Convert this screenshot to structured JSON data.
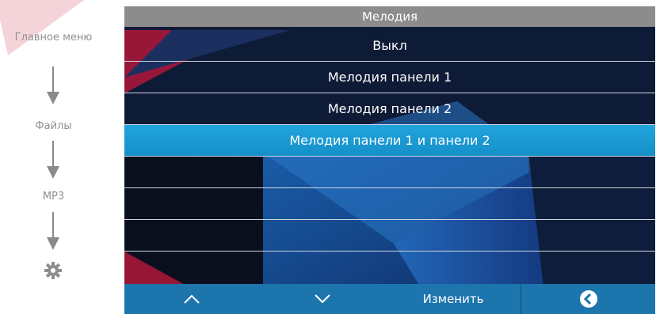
{
  "breadcrumb": {
    "items": [
      "Главное меню",
      "Файлы",
      "MP3"
    ],
    "icon": "gear-icon"
  },
  "menu": {
    "title": "Мелодия",
    "options": [
      "Выкл",
      "Мелодия панели 1",
      "Мелодия панели 2",
      "Мелодия панели 1 и панели 2",
      "",
      "",
      "",
      ""
    ],
    "selected_index": 3
  },
  "toolbar": {
    "up_icon": "chevron-up-icon",
    "down_icon": "chevron-down-icon",
    "change_label": "Изменить",
    "back_icon": "back-circle-icon"
  },
  "colors": {
    "selected": "#1a9bd6",
    "bar": "#1d75ad",
    "title_bar": "#8c8c8c"
  }
}
